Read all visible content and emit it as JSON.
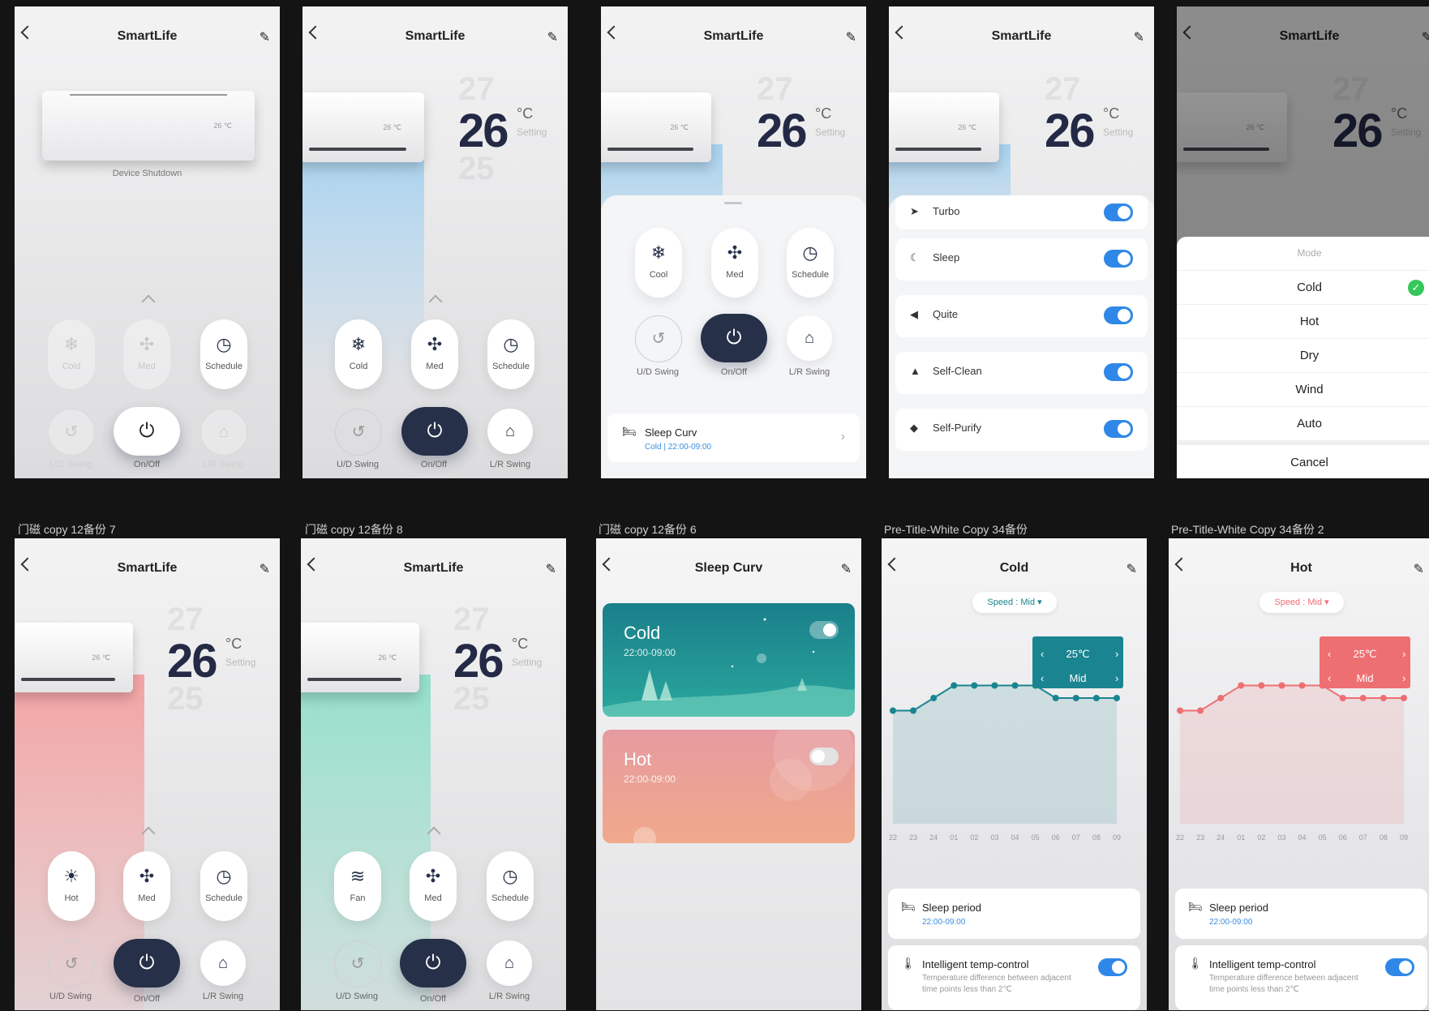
{
  "app_title": "SmartLife",
  "frame_labels": {
    "r2c1": "门磁 copy 12备份 7",
    "r2c2": "门磁 copy 12备份 8",
    "r2c3": "门磁 copy 12备份 6",
    "r2c4": "Pre-Title-White Copy 34备份",
    "r2c5": "Pre-Title-White Copy 34备份 2"
  },
  "temperature": {
    "value": "26",
    "unit": "°C",
    "setting": "Setting",
    "above": "27",
    "below": "25"
  },
  "device_status": "Device Shutdown",
  "ac_tiny": "26 ℃",
  "controls": {
    "cold": "Cold",
    "cool": "Cool",
    "med": "Med",
    "schedule": "Schedule",
    "hot": "Hot",
    "fan": "Fan",
    "ud_swing": "U/D Swing",
    "onoff": "On/Off",
    "lr_swing": "L/R Swing"
  },
  "sleep_card": {
    "title": "Sleep Curv",
    "subtitle": "Cold | 22:00-09:00"
  },
  "features": [
    {
      "name": "Turbo",
      "on": true
    },
    {
      "name": "Sleep",
      "on": true
    },
    {
      "name": "Quite",
      "on": true
    },
    {
      "name": "Self-Clean",
      "on": true
    },
    {
      "name": "Self-Purify",
      "on": true
    }
  ],
  "mode_sheet": {
    "title": "Mode",
    "options": [
      "Cold",
      "Hot",
      "Dry",
      "Wind",
      "Auto"
    ],
    "selected": "Cold",
    "cancel": "Cancel"
  },
  "sleep_curv_page": {
    "title": "Sleep Curv",
    "cards": [
      {
        "name": "Cold",
        "time": "22:00-09:00",
        "on": true,
        "color": "#1b8f94"
      },
      {
        "name": "Hot",
        "time": "22:00-09:00",
        "on": false,
        "color": "#e79d9a"
      }
    ]
  },
  "curve_pages": [
    {
      "title": "Cold",
      "speed": "Speed : Mid",
      "accent": "#1a8590"
    },
    {
      "title": "Hot",
      "speed": "Speed : Mid",
      "accent": "#ee6f72"
    }
  ],
  "chart_data": {
    "type": "line",
    "x": [
      "22",
      "23",
      "24",
      "01",
      "02",
      "03",
      "04",
      "05",
      "06",
      "07",
      "08",
      "09"
    ],
    "series": [
      {
        "values": [
          25,
          25,
          26,
          27,
          27,
          27,
          27,
          27,
          26,
          26,
          26,
          26
        ]
      }
    ],
    "ylim": [
      16,
      32
    ],
    "tooltip": {
      "temp": "25℃",
      "speed": "Mid"
    }
  },
  "bottom_cards": {
    "sleep_period": "Sleep period",
    "sleep_time": "22:00-09:00",
    "intelligent": "Intelligent temp-control",
    "intelligent_desc": "Temperature difference between adjacent time points less than 2℃"
  }
}
